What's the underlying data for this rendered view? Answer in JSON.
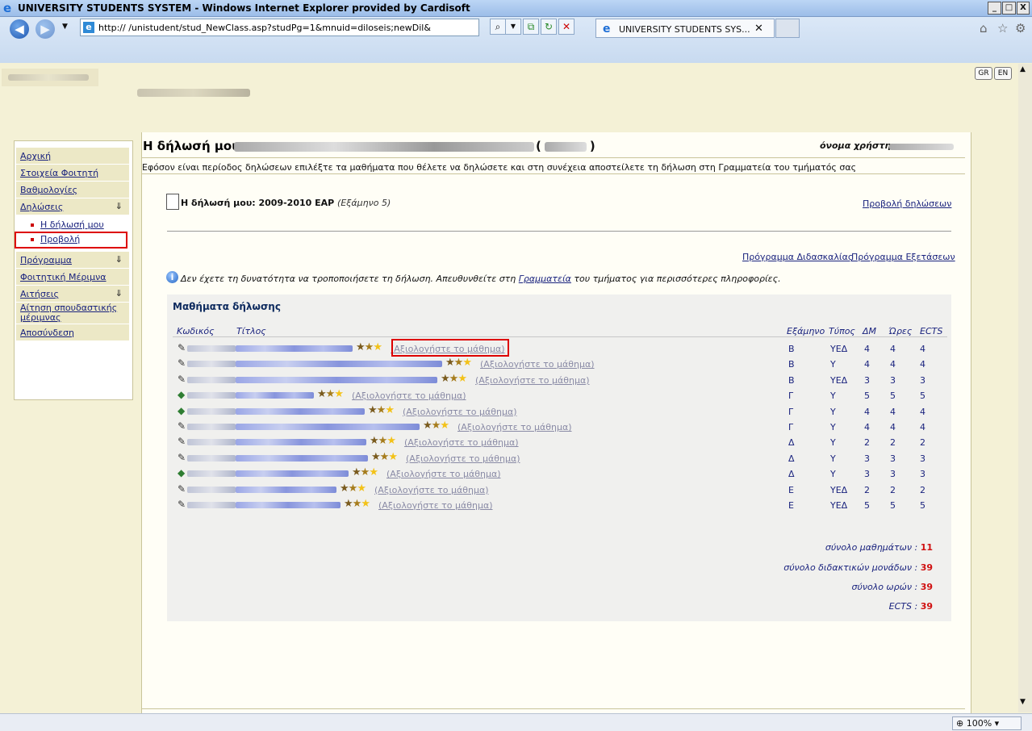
{
  "window": {
    "title": "UNIVERSITY STUDENTS SYSTEM - Windows Internet Explorer provided by Cardisoft",
    "controls": [
      "_",
      "□",
      "X"
    ]
  },
  "browser": {
    "url": "http://                /unistudent/stud_NewClass.asp?studPg=1&mnuid=diloseis;newDil&",
    "tab_title": "UNIVERSITY STUDENTS SYS...",
    "tab_close": "✕",
    "zoom": "100%"
  },
  "lang_buttons": [
    "GR",
    "EN"
  ],
  "sidebar": {
    "items": [
      {
        "label": "Αρχική"
      },
      {
        "label": "Στοιχεία Φοιτητή"
      },
      {
        "label": "Βαθμολογίες"
      },
      {
        "label": "Δηλώσεις",
        "expanded": true
      },
      {
        "label": "Πρόγραμμα"
      },
      {
        "label": "Φοιτητική Μέριμνα"
      },
      {
        "label": "Αιτήσεις"
      },
      {
        "label": "Αίτηση σπουδαστικής μέριμνας"
      },
      {
        "label": "Αποσύνδεση"
      }
    ],
    "subitems": [
      "Η δήλωσή μου",
      "Προβολή"
    ]
  },
  "header": {
    "title": "Η δήλωσή μου-",
    "username_label": "όνομα χρήστη:"
  },
  "instructions": "Εφόσον είναι περίοδος δηλώσεων επιλέξτε τα μαθήματα που θέλετε να δηλώσετε και στη συνέχεια αποστείλετε τη δήλωση στη Γραμματεία του τμήματός σας",
  "declaration": {
    "title": "Η δήλωσή μου: 2009-2010 ΕΑΡ",
    "semester": "(Εξάμηνο 5)",
    "view_link": "Προβολή δηλώσεων",
    "program_link": "Πρόγραμμα Διδασκαλίας",
    "exams_link": "Πρόγραμμα Εξετάσεων",
    "info_pre": "Δεν έχετε τη δυνατότητα να τροποποιήσετε τη δήλωση. Απευθυνθείτε στη ",
    "info_link": "Γραμματεία",
    "info_post": " του τμήματος για περισσότερες πληροφορίες."
  },
  "courses": {
    "title": "Μαθήματα δήλωσης",
    "columns": [
      "Κωδικός",
      "Τίτλος",
      "Εξάμηνο",
      "Τύπος",
      "ΔΜ",
      "Ώρες",
      "ECTS"
    ],
    "rate_label": "(Αξιολογήστε το μάθημα)",
    "rows": [
      {
        "sem": "Β",
        "type": "ΥΕΔ",
        "dm": "4",
        "hours": "4",
        "ects": "4",
        "stars": 2
      },
      {
        "sem": "Β",
        "type": "Υ",
        "dm": "4",
        "hours": "4",
        "ects": "4",
        "stars": 2
      },
      {
        "sem": "Β",
        "type": "ΥΕΔ",
        "dm": "3",
        "hours": "3",
        "ects": "3",
        "stars": 2
      },
      {
        "sem": "Γ",
        "type": "Υ",
        "dm": "5",
        "hours": "5",
        "ects": "5",
        "stars": 2
      },
      {
        "sem": "Γ",
        "type": "Υ",
        "dm": "4",
        "hours": "4",
        "ects": "4",
        "stars": 2
      },
      {
        "sem": "Γ",
        "type": "Υ",
        "dm": "4",
        "hours": "4",
        "ects": "4",
        "stars": 2
      },
      {
        "sem": "Δ",
        "type": "Υ",
        "dm": "2",
        "hours": "2",
        "ects": "2",
        "stars": 2
      },
      {
        "sem": "Δ",
        "type": "Υ",
        "dm": "3",
        "hours": "3",
        "ects": "3",
        "stars": 2
      },
      {
        "sem": "Δ",
        "type": "Υ",
        "dm": "3",
        "hours": "3",
        "ects": "3",
        "stars": 2
      },
      {
        "sem": "Ε",
        "type": "ΥΕΔ",
        "dm": "2",
        "hours": "2",
        "ects": "2",
        "stars": 2
      },
      {
        "sem": "Ε",
        "type": "ΥΕΔ",
        "dm": "5",
        "hours": "5",
        "ects": "5",
        "stars": 2
      }
    ],
    "totals": [
      {
        "label": "σύνολο μαθημάτων :",
        "value": "11"
      },
      {
        "label": "σύνολο διδακτικών μονάδων :",
        "value": "39"
      },
      {
        "label": "σύνολο ωρών :",
        "value": "39"
      },
      {
        "label": "ECTS :",
        "value": "39"
      }
    ]
  }
}
